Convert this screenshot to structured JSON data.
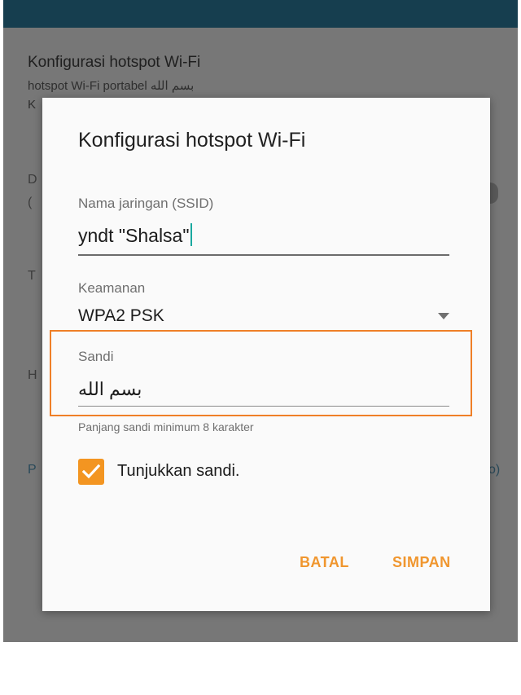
{
  "background": {
    "title": "Konfigurasi hotspot Wi-Fi",
    "subtitle": "hotspot Wi-Fi portabel بسم الله",
    "subtitle2_fragment": "K",
    "left_fragments": [
      "D",
      "(",
      "T",
      "H",
      "P"
    ],
    "right_fragment": "o)"
  },
  "dialog": {
    "title": "Konfigurasi hotspot Wi-Fi",
    "ssid": {
      "label": "Nama jaringan (SSID)",
      "value": "yndt \"Shalsa\""
    },
    "security": {
      "label": "Keamanan",
      "value": "WPA2 PSK"
    },
    "password": {
      "label": "Sandi",
      "value": "بسم الله",
      "hint": "Panjang sandi minimum 8 karakter"
    },
    "show_password": {
      "label": "Tunjukkan sandi.",
      "checked": true
    },
    "buttons": {
      "cancel": "BATAL",
      "save": "SIMPAN"
    }
  },
  "colors": {
    "accent": "#f39521",
    "highlight": "#ef7f27",
    "appbar": "#163e4f"
  }
}
